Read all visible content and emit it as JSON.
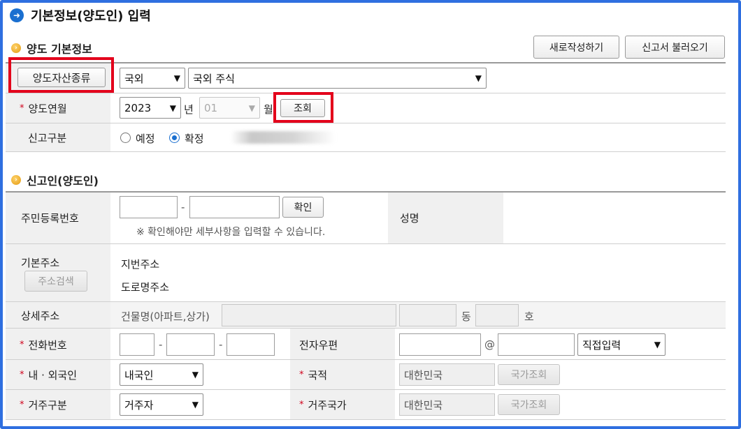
{
  "page": {
    "title": "기본정보(양도인) 입력"
  },
  "section1": {
    "title": "양도 기본정보",
    "new_button": "새로작성하기",
    "load_button": "신고서 불러오기",
    "asset_type": {
      "label": "양도자산종류",
      "region": "국외",
      "kind": "국외 주식"
    },
    "transfer_date": {
      "label": "양도연월",
      "year": "2023",
      "year_unit": "년",
      "month": "01",
      "month_unit": "월",
      "lookup_button": "조회"
    },
    "report_type": {
      "label": "신고구분",
      "option1": "예정",
      "option2": "확정",
      "selected": "확정"
    }
  },
  "section2": {
    "title": "신고인(양도인)",
    "rrn": {
      "label": "주민등록번호",
      "dash": "-",
      "confirm_button": "확인",
      "note": "※ 확인해야만 세부사항을 입력할 수 있습니다."
    },
    "name": {
      "label": "성명"
    },
    "address": {
      "label": "기본주소",
      "search_button": "주소검색",
      "lot_label": "지번주소",
      "road_label": "도로명주소"
    },
    "detail_address": {
      "label": "상세주소",
      "building_label": "건물명(아파트,상가)",
      "dong": "동",
      "ho": "호"
    },
    "phone": {
      "label": "전화번호",
      "dash1": "-",
      "dash2": "-"
    },
    "email": {
      "label": "전자우편",
      "at": "@",
      "domain_select": "직접입력"
    },
    "citizenship": {
      "label": "내 · 외국인",
      "value": "내국인"
    },
    "nationality": {
      "label": "국적",
      "value": "대한민국",
      "lookup_button": "국가조회"
    },
    "residency": {
      "label": "거주구분",
      "value": "거주자"
    },
    "residence_country": {
      "label": "거주국가",
      "value": "대한민국",
      "lookup_button": "국가조회"
    }
  },
  "colors": {
    "highlight": "#e3001b",
    "frame": "#2f6fe0",
    "accent": "#1a6fd0"
  }
}
